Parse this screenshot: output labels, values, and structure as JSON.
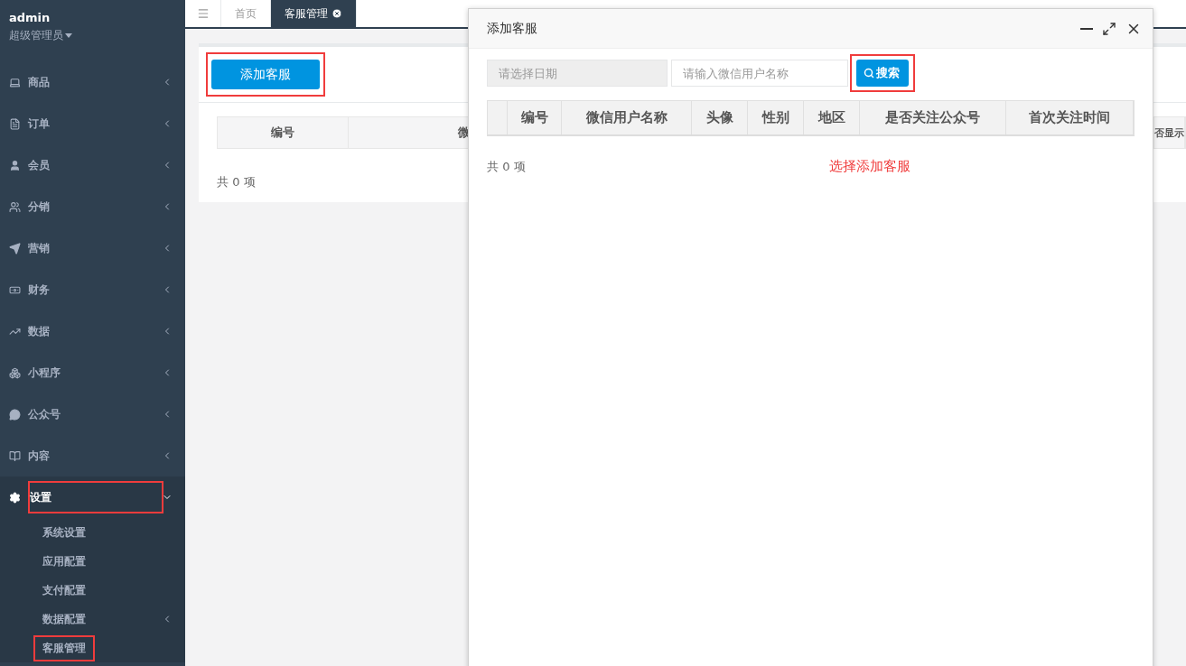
{
  "user": {
    "name": "admin",
    "role": "超级管理员"
  },
  "menu": [
    {
      "label": "商品",
      "expanded": false,
      "highlighted": false
    },
    {
      "label": "订单",
      "expanded": false,
      "highlighted": false
    },
    {
      "label": "会员",
      "expanded": false,
      "highlighted": false
    },
    {
      "label": "分销",
      "expanded": false,
      "highlighted": false
    },
    {
      "label": "营销",
      "expanded": false,
      "highlighted": false
    },
    {
      "label": "财务",
      "expanded": false,
      "highlighted": false
    },
    {
      "label": "数据",
      "expanded": false,
      "highlighted": false
    },
    {
      "label": "小程序",
      "expanded": false,
      "highlighted": false
    },
    {
      "label": "公众号",
      "expanded": false,
      "highlighted": false
    },
    {
      "label": "内容",
      "expanded": false,
      "highlighted": false
    },
    {
      "label": "设置",
      "expanded": true,
      "highlighted": true,
      "children": [
        {
          "label": "系统设置",
          "expandable": false,
          "highlighted": false
        },
        {
          "label": "应用配置",
          "expandable": false,
          "highlighted": false
        },
        {
          "label": "支付配置",
          "expandable": false,
          "highlighted": false
        },
        {
          "label": "数据配置",
          "expandable": true,
          "highlighted": false
        },
        {
          "label": "客服管理",
          "expandable": false,
          "highlighted": true
        }
      ]
    }
  ],
  "tabs": [
    {
      "label": "首页",
      "selected": false,
      "closable": false
    },
    {
      "label": "客服管理",
      "selected": true,
      "closable": true
    }
  ],
  "page": {
    "add_button": {
      "label": "添加客服",
      "highlighted": true
    },
    "columns": [
      "编号",
      "微",
      "否显示"
    ],
    "footer": "共 0 项"
  },
  "dialog": {
    "title": "添加客服",
    "date_field": {
      "placeholder": "请选择日期"
    },
    "name_field": {
      "placeholder": "请输入微信用户名称"
    },
    "search_button": {
      "label": "搜索",
      "highlighted": true
    },
    "columns": [
      "编号",
      "微信用户名称",
      "头像",
      "性别",
      "地区",
      "是否关注公众号",
      "首次关注时间"
    ],
    "footer": "共 0 项",
    "note": "选择添加客服"
  }
}
